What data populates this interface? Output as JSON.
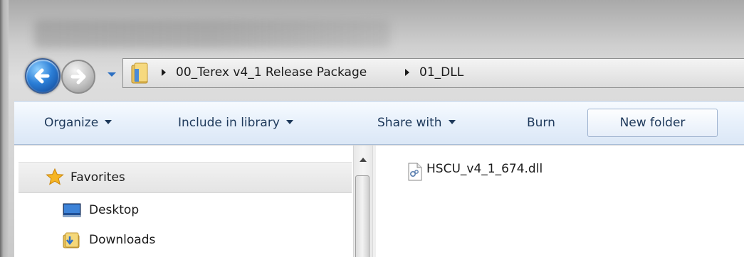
{
  "navigation": {
    "back_icon": "back-arrow-icon",
    "forward_icon": "forward-arrow-icon",
    "recent_icon": "chevron-down-icon"
  },
  "address_bar": {
    "breadcrumbs": [
      "00_Terex v4_1 Release Package",
      "01_DLL"
    ]
  },
  "toolbar": {
    "organize_label": "Organize",
    "include_label": "Include in library",
    "share_label": "Share with",
    "burn_label": "Burn",
    "new_folder_label": "New folder"
  },
  "nav_pane": {
    "favorites_label": "Favorites",
    "items": [
      {
        "label": "Desktop",
        "icon": "desktop-icon"
      },
      {
        "label": "Downloads",
        "icon": "downloads-folder-icon"
      }
    ]
  },
  "files": [
    {
      "name": "HSCU_v4_1_674.dll",
      "icon": "dll-file-icon"
    }
  ],
  "colors": {
    "toolbar_text": "#1e395b",
    "back_button": "#2c7fd7"
  }
}
